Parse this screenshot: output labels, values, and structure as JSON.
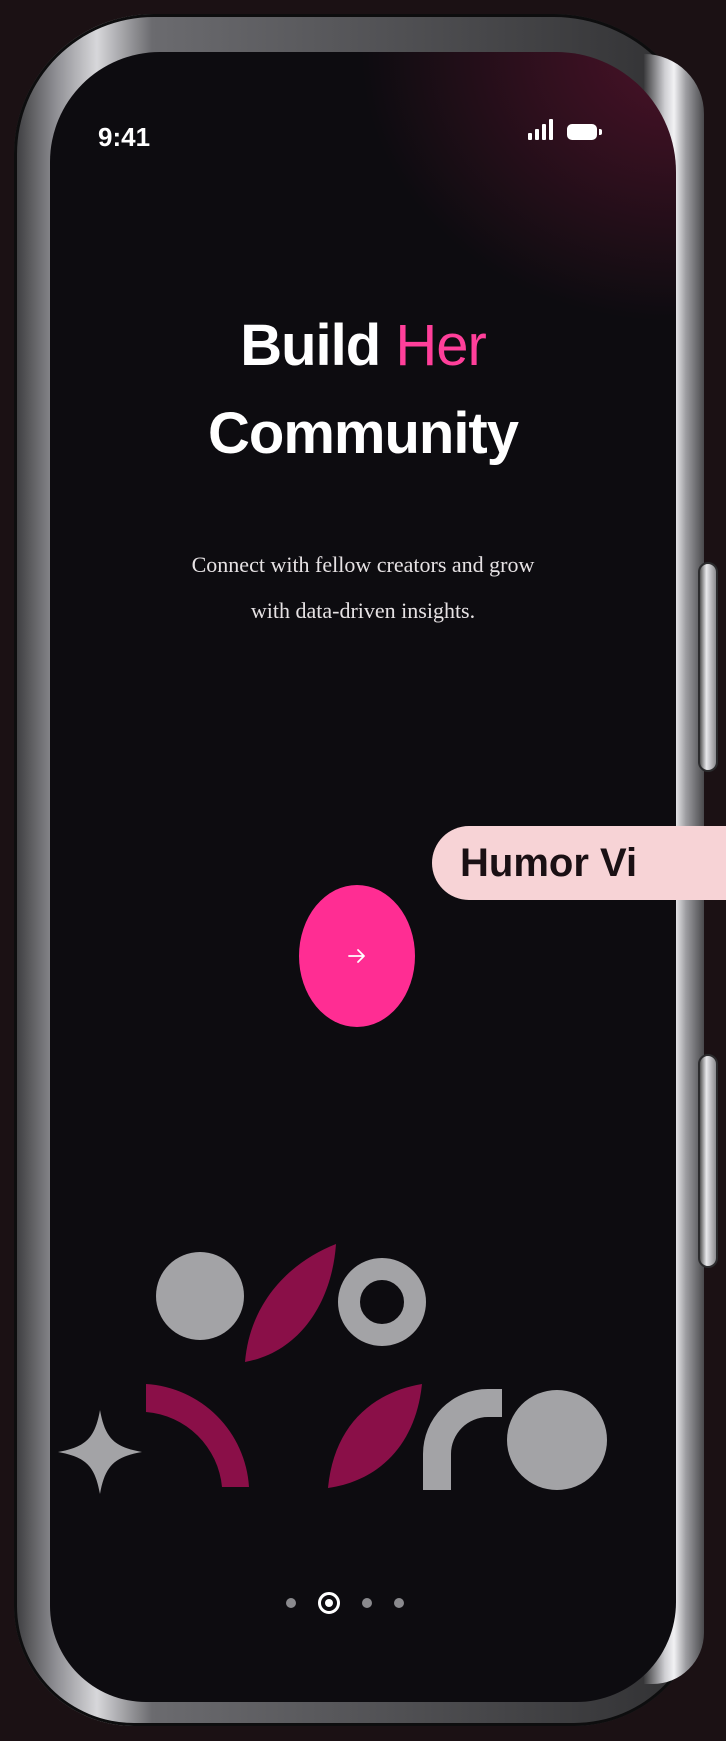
{
  "status_bar": {
    "time": "9:41"
  },
  "onboarding": {
    "title_part1": "Build ",
    "title_accent": "Her",
    "title_part2": "Community",
    "subtitle_line1": "Connect with fellow creators and grow",
    "subtitle_line2": "with data-driven insights.",
    "next_button_icon": "arrow-right-icon",
    "pagination": {
      "total": 4,
      "active_index": 1
    }
  },
  "overlay_badge": {
    "label": "Humor Vi"
  },
  "colors": {
    "accent_pink": "#ff3f9a",
    "button_pink": "#ff2d93",
    "shape_magenta": "#8a0f48",
    "shape_gray": "#a3a3a6",
    "badge_bg": "#f7d3d6",
    "screen_bg": "#0d0c10"
  }
}
